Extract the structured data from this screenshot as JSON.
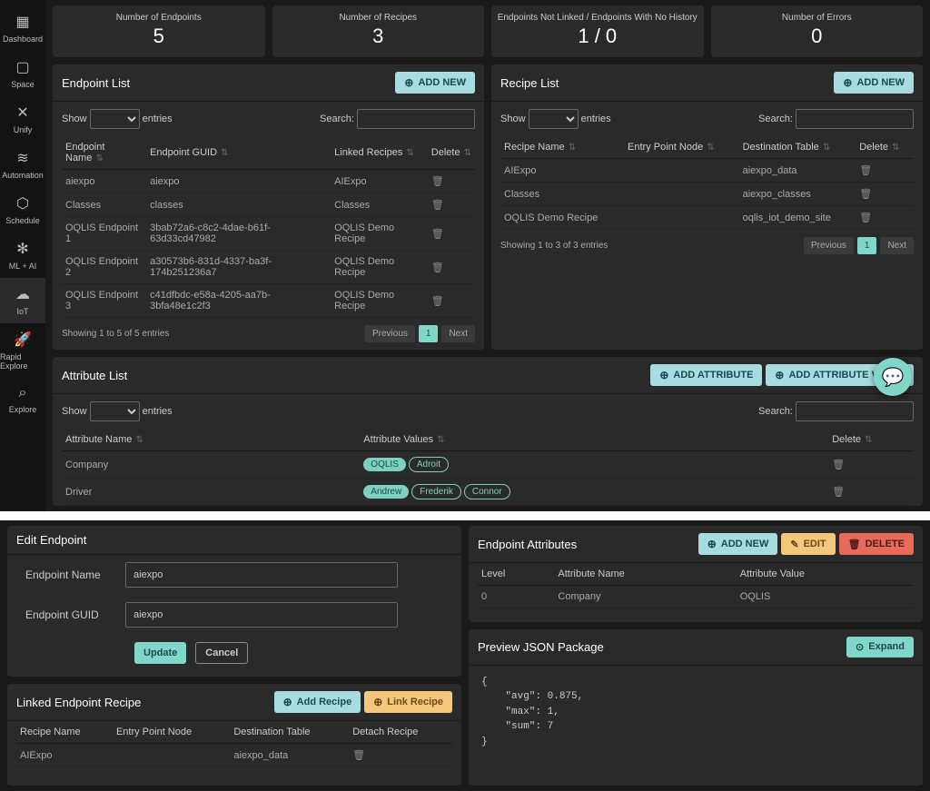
{
  "sidebar": {
    "items": [
      {
        "icon": "▦",
        "label": "Dashboard"
      },
      {
        "icon": "▢",
        "label": "Space"
      },
      {
        "icon": "✕",
        "label": "Unify"
      },
      {
        "icon": "≋",
        "label": "Automation"
      },
      {
        "icon": "⬡",
        "label": "Schedule"
      },
      {
        "icon": "✻",
        "label": "ML + AI"
      },
      {
        "icon": "☁",
        "label": "IoT",
        "active": true
      },
      {
        "icon": "🚀",
        "label": "Rapid Explore"
      },
      {
        "icon": "⌕",
        "label": "Explore"
      }
    ]
  },
  "stats": [
    {
      "label": "Number of Endpoints",
      "value": "5"
    },
    {
      "label": "Number of Recipes",
      "value": "3"
    },
    {
      "label": "Endpoints Not Linked / Endpoints With No History",
      "value": "1 / 0"
    },
    {
      "label": "Number of Errors",
      "value": "0"
    }
  ],
  "common": {
    "show": "Show",
    "entries": "entries",
    "search": "Search:",
    "prev": "Previous",
    "next": "Next",
    "page": "1",
    "delete": "Delete"
  },
  "endpointList": {
    "title": "Endpoint List",
    "addNew": "ADD NEW",
    "headers": [
      "Endpoint Name",
      "Endpoint GUID",
      "Linked Recipes",
      "Delete"
    ],
    "rows": [
      {
        "name": "aiexpo",
        "guid": "aiexpo",
        "recipe": "AIExpo"
      },
      {
        "name": "Classes",
        "guid": "classes",
        "recipe": "Classes"
      },
      {
        "name": "OQLIS Endpoint 1",
        "guid": "3bab72a6-c8c2-4dae-b61f-63d33cd47982",
        "recipe": "OQLIS Demo Recipe"
      },
      {
        "name": "OQLIS Endpoint 2",
        "guid": "a30573b6-831d-4337-ba3f-174b251236a7",
        "recipe": "OQLIS Demo Recipe"
      },
      {
        "name": "OQLIS Endpoint 3",
        "guid": "c41dfbdc-e58a-4205-aa7b-3bfa48e1c2f3",
        "recipe": "OQLIS Demo Recipe"
      }
    ],
    "summary": "Showing 1 to 5 of 5 entries"
  },
  "recipeList": {
    "title": "Recipe List",
    "addNew": "ADD NEW",
    "headers": [
      "Recipe Name",
      "Entry Point Node",
      "Destination Table",
      "Delete"
    ],
    "rows": [
      {
        "name": "AIExpo",
        "entry": "",
        "dest": "aiexpo_data"
      },
      {
        "name": "Classes",
        "entry": "",
        "dest": "aiexpo_classes"
      },
      {
        "name": "OQLIS Demo Recipe",
        "entry": "",
        "dest": "oqlis_iot_demo_site"
      }
    ],
    "summary": "Showing 1 to 3 of 3 entries"
  },
  "attributeList": {
    "title": "Attribute List",
    "addAttr": "ADD ATTRIBUTE",
    "addAttrVal": "ADD ATTRIBUTE VALUE",
    "headers": [
      "Attribute Name",
      "Attribute Values",
      "Delete"
    ],
    "rows": [
      {
        "name": "Company",
        "filled": "OQLIS",
        "tags": [
          "Adroit"
        ]
      },
      {
        "name": "Driver",
        "filled": "Andrew",
        "tags": [
          "Frederik",
          "Connor"
        ]
      }
    ]
  },
  "editEndpoint": {
    "title": "Edit Endpoint",
    "nameLabel": "Endpoint Name",
    "nameValue": "aiexpo",
    "guidLabel": "Endpoint GUID",
    "guidValue": "aiexpo",
    "update": "Update",
    "cancel": "Cancel"
  },
  "linkedRecipe": {
    "title": "Linked Endpoint Recipe",
    "addRecipe": "Add Recipe",
    "linkRecipe": "Link Recipe",
    "headers": [
      "Recipe Name",
      "Entry Point Node",
      "Destination Table",
      "Detach Recipe"
    ],
    "rows": [
      {
        "name": "AIExpo",
        "entry": "",
        "dest": "aiexpo_data"
      }
    ]
  },
  "endpointAttrs": {
    "title": "Endpoint Attributes",
    "addNew": "ADD NEW",
    "edit": "EDIT",
    "del": "DELETE",
    "headers": [
      "Level",
      "Attribute Name",
      "Attribute Value"
    ],
    "rows": [
      {
        "level": "0",
        "name": "Company",
        "value": "OQLIS"
      }
    ]
  },
  "preview": {
    "title": "Preview JSON Package",
    "expand": "Expand",
    "json": "{\n    \"avg\": 0.875,\n    \"max\": 1,\n    \"sum\": 7\n}"
  }
}
